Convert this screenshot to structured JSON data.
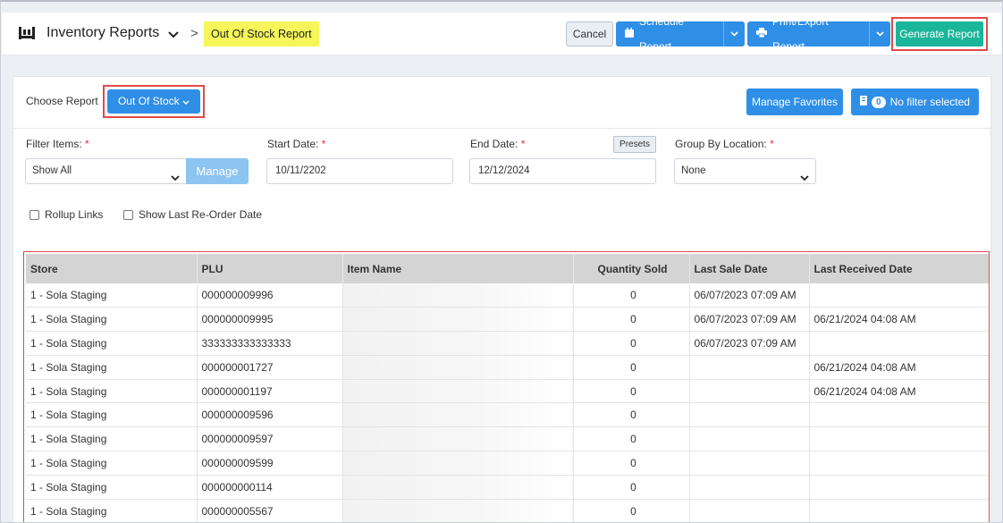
{
  "header": {
    "title": "Inventory Reports",
    "breadcrumb_separator": ">",
    "breadcrumb_current": "Out Of Stock Report",
    "cancel_label": "Cancel",
    "schedule_label": "Schedule Report",
    "print_label": "Print/Export Report",
    "generate_label": "Generate Report"
  },
  "toolbar": {
    "choose_label": "Choose Report",
    "choose_value": "Out Of Stock",
    "favorites_label": "Manage Favorites",
    "filter_count": "0",
    "filter_label": "No filter selected"
  },
  "filters": {
    "filter_items_label": "Filter Items:",
    "filter_items_value": "Show All",
    "manage_label": "Manage",
    "start_date_label": "Start Date:",
    "start_date_value": "10/11/2202",
    "end_date_label": "End Date:",
    "end_date_value": "12/12/2024",
    "presets_label": "Presets",
    "group_by_label": "Group By Location:",
    "group_by_value": "None",
    "required_mark": "*",
    "rollup_label": "Rollup Links",
    "reorder_label": "Show Last Re-Order Date"
  },
  "table": {
    "columns": [
      "Store",
      "PLU",
      "Item Name",
      "Quantity Sold",
      "Last Sale Date",
      "Last Received Date"
    ],
    "rows": [
      {
        "store": "1 - Sola Staging",
        "plu": "000000009996",
        "item": "",
        "qty": "0",
        "sale": "06/07/2023 07:09 AM",
        "recv": ""
      },
      {
        "store": "1 - Sola Staging",
        "plu": "000000009995",
        "item": "",
        "qty": "0",
        "sale": "06/07/2023 07:09 AM",
        "recv": "06/21/2024 04:08 AM"
      },
      {
        "store": "1 - Sola Staging",
        "plu": "333333333333333",
        "item": "",
        "qty": "0",
        "sale": "06/07/2023 07:09 AM",
        "recv": ""
      },
      {
        "store": "1 - Sola Staging",
        "plu": "000000001727",
        "item": "",
        "qty": "0",
        "sale": "",
        "recv": "06/21/2024 04:08 AM"
      },
      {
        "store": "1 - Sola Staging",
        "plu": "000000001197",
        "item": "",
        "qty": "0",
        "sale": "",
        "recv": "06/21/2024 04:08 AM"
      },
      {
        "store": "1 - Sola Staging",
        "plu": "000000009596",
        "item": "",
        "qty": "0",
        "sale": "",
        "recv": ""
      },
      {
        "store": "1 - Sola Staging",
        "plu": "000000009597",
        "item": "",
        "qty": "0",
        "sale": "",
        "recv": ""
      },
      {
        "store": "1 - Sola Staging",
        "plu": "000000009599",
        "item": "",
        "qty": "0",
        "sale": "",
        "recv": ""
      },
      {
        "store": "1 - Sola Staging",
        "plu": "000000000114",
        "item": "",
        "qty": "0",
        "sale": "",
        "recv": ""
      },
      {
        "store": "1 - Sola Staging",
        "plu": "000000005567",
        "item": "",
        "qty": "0",
        "sale": "",
        "recv": ""
      }
    ]
  },
  "icons": {
    "report": "report-icon",
    "calendar": "calendar-icon",
    "printer": "printer-icon",
    "filter": "filter-icon"
  },
  "colors": {
    "primary": "#2f8fe6",
    "success": "#1bb59a",
    "highlight": "#f6f65a",
    "annotation": "#e04a4a"
  }
}
